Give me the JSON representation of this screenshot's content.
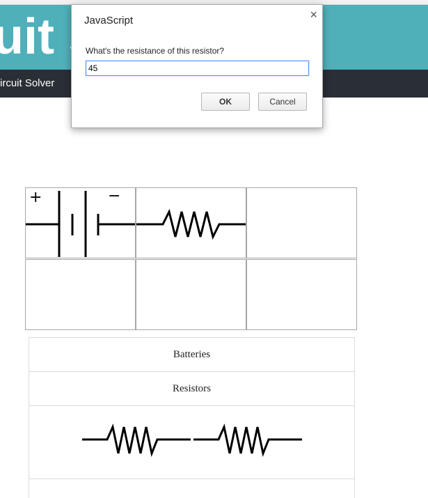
{
  "header": {
    "title": "uit s"
  },
  "nav": {
    "item": "ircuit Solver"
  },
  "grid": {
    "battery": {
      "plus": "+",
      "minus": "−"
    }
  },
  "palette": {
    "batteries_label": "Batteries",
    "resistors_label": "Resistors"
  },
  "dialog": {
    "title": "JavaScript",
    "close_glyph": "×",
    "message": "What's the resistance of this resistor?",
    "input_value": "45",
    "ok_label": "OK",
    "cancel_label": "Cancel"
  }
}
